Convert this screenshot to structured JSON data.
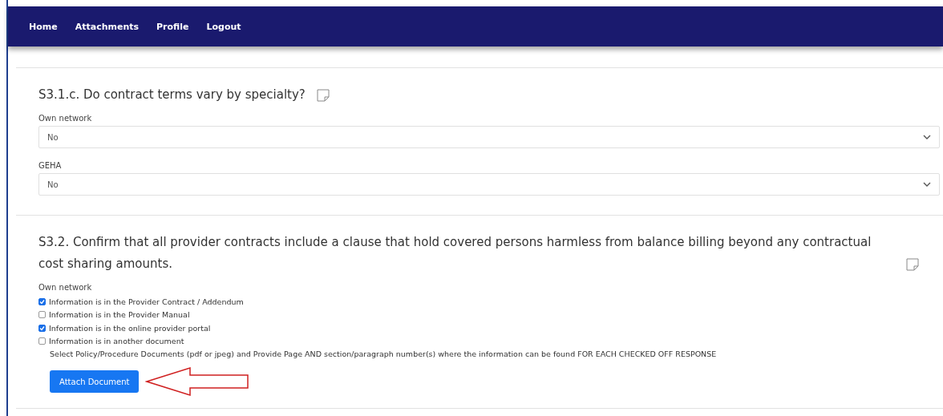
{
  "nav": {
    "items": [
      "Home",
      "Attachments",
      "Profile",
      "Logout"
    ]
  },
  "questions": [
    {
      "title": "S3.1.c. Do contract terms vary by specialty?",
      "groups": [
        {
          "kind": "select",
          "label": "Own network",
          "value": "No"
        },
        {
          "kind": "select",
          "label": "GEHA",
          "value": "No"
        }
      ]
    },
    {
      "title": "S3.2. Confirm that all provider contracts include a clause that hold covered persons harmless from balance billing beyond any contractual cost sharing amounts.",
      "groups": [
        {
          "kind": "checklist",
          "label": "Own network",
          "options": [
            {
              "label": "Information is in the Provider Contract / Addendum",
              "checked": true
            },
            {
              "label": "Information is in the Provider Manual",
              "checked": false
            },
            {
              "label": "Information is in the online provider portal",
              "checked": true
            },
            {
              "label": "Information is in another document",
              "checked": false
            }
          ],
          "instruction": "Select Policy/Procedure Documents (pdf or jpeg) and Provide Page AND section/paragraph number(s) where the information can be found FOR EACH CHECKED OFF RESPONSE",
          "button": "Attach Document"
        }
      ]
    }
  ]
}
